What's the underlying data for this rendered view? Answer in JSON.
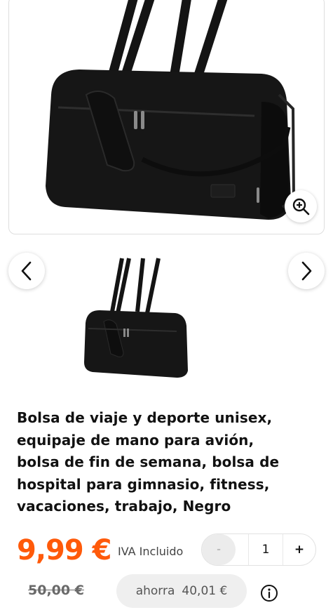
{
  "product": {
    "title_lines": [
      "Bolsa de viaje y deporte unisex,",
      "equipaje de mano para avión,",
      "bolsa de fin de semana, bolsa de",
      "hospital para gimnasio, fitness,",
      "vacaciones, trabajo, Negro"
    ],
    "price": "9,99 €",
    "vat_label": "IVA Incluido",
    "old_price": "50,00 €",
    "savings_label": "ahorra",
    "savings_amount": "40,01 €"
  },
  "quantity": {
    "minus_label": "-",
    "value": "1",
    "plus_label": "+"
  },
  "colors": {
    "price": "#ff5a0a",
    "bag": "#141414"
  },
  "icons": {
    "zoom": "zoom-in-icon",
    "prev": "chevron-left-icon",
    "next": "chevron-right-icon",
    "info": "info-icon"
  }
}
